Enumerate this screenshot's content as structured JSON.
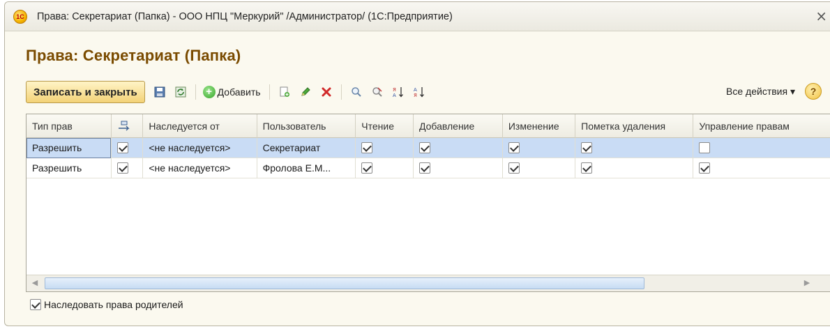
{
  "window": {
    "logo_text": "1С",
    "title": "Права: Секретариат (Папка) - ООО НПЦ \"Меркурий\" /Администратор/  (1С:Предприятие)",
    "close_glyph": "×"
  },
  "form": {
    "title": "Права: Секретариат (Папка)"
  },
  "toolbar": {
    "save_close_label": "Записать и закрыть",
    "add_label": "Добавить",
    "all_actions_label": "Все действия ▾",
    "help_label": "?",
    "icons": [
      "save-icon",
      "refresh-icon",
      "add-icon",
      "copy-icon",
      "edit-icon",
      "delete-icon",
      "search-icon",
      "clear-search-icon",
      "sort-desc-icon",
      "sort-asc-icon"
    ]
  },
  "grid": {
    "columns": [
      "Тип прав",
      "",
      "Наследуется от",
      "Пользователь",
      "Чтение",
      "Добавление",
      "Изменение",
      "Пометка удаления",
      "Управление правам"
    ],
    "rows": [
      {
        "type": "Разрешить",
        "inherit_flag": true,
        "inherited_from": "<не наследуется>",
        "user": "Секретариат",
        "read": true,
        "add": true,
        "change": true,
        "mark_delete": true,
        "manage_rights": false
      },
      {
        "type": "Разрешить",
        "inherit_flag": true,
        "inherited_from": "<не наследуется>",
        "user": "Фролова Е.М...",
        "read": true,
        "add": true,
        "change": true,
        "mark_delete": true,
        "manage_rights": true
      }
    ],
    "selected_row": 0
  },
  "footer": {
    "inherit_parent_label": "Наследовать права родителей",
    "inherit_parent_checked": true
  },
  "colors": {
    "title_color": "#7a4b00",
    "selection": "#c9dcf5",
    "primary_button": "#f3d277"
  }
}
